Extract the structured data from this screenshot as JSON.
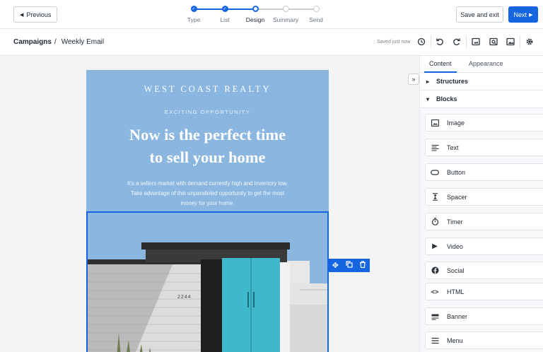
{
  "topbar": {
    "previous_label": "Previous",
    "save_exit_label": "Save and exit",
    "next_label": "Next",
    "steps": [
      {
        "label": "Type",
        "state": "done"
      },
      {
        "label": "List",
        "state": "done"
      },
      {
        "label": "Design",
        "state": "current"
      },
      {
        "label": "Summary",
        "state": "todo"
      },
      {
        "label": "Send",
        "state": "todo"
      }
    ]
  },
  "breadcrumb": {
    "root": "Campaigns",
    "separator": "/",
    "current": "Weekly Email"
  },
  "toolbar": {
    "status": "Saved just now",
    "icons": [
      "history-icon",
      "undo-icon",
      "redo-icon",
      "desktop-preview-icon",
      "mobile-preview-icon",
      "image-preview-icon",
      "settings-icon"
    ]
  },
  "email": {
    "brand": "WEST COAST REALTY",
    "eyebrow": "EXCITING OPPORTUNITY",
    "headline_line1": "Now is the perfect time",
    "headline_line2": "to sell your home",
    "body_line1": "It's a sellers market with demand currently high and inventory low.",
    "body_line2": "Take advantage of this unparalleled opportunity to get the most",
    "body_line3": "money for your home.",
    "house_number": "2244"
  },
  "panel": {
    "tabs": [
      "Content",
      "Appearance"
    ],
    "active_tab": "Content",
    "sections": {
      "structures": "Structures",
      "blocks": "Blocks"
    },
    "blocks": [
      {
        "label": "Image",
        "icon": "image-icon"
      },
      {
        "label": "Text",
        "icon": "text-icon"
      },
      {
        "label": "Button",
        "icon": "button-icon"
      },
      {
        "label": "Spacer",
        "icon": "spacer-icon"
      },
      {
        "label": "Timer",
        "icon": "timer-icon"
      },
      {
        "label": "Video",
        "icon": "video-icon"
      },
      {
        "label": "Social",
        "icon": "social-icon"
      },
      {
        "label": "HTML",
        "icon": "html-icon"
      },
      {
        "label": "Banner",
        "icon": "banner-icon"
      },
      {
        "label": "Menu",
        "icon": "menu-icon"
      }
    ]
  },
  "colors": {
    "accent": "#1565e0",
    "email_background": "#8ab6e0",
    "door": "#3fb8cc"
  }
}
